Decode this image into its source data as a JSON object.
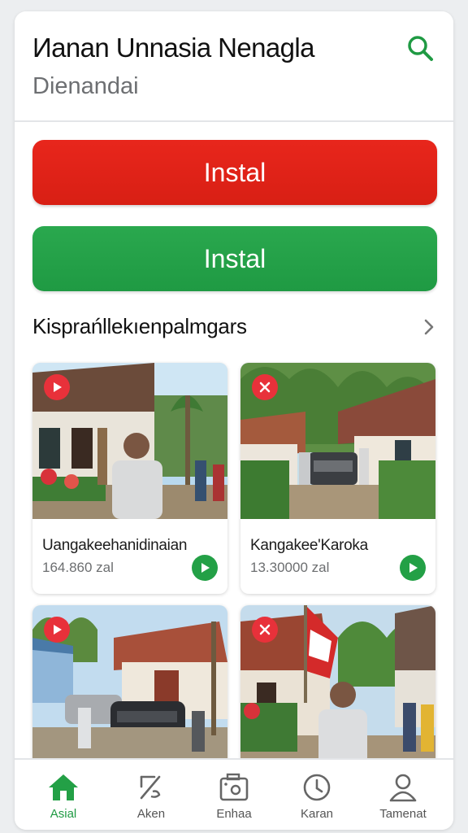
{
  "header": {
    "title": "Иanan Unnasia Nenagla",
    "subtitle": "Dienandai",
    "search_icon": "search-icon"
  },
  "actions": {
    "primary_label": "Instal",
    "secondary_label": "Instal",
    "primary_color": "#e0241a",
    "secondary_color": "#26a34a"
  },
  "section": {
    "title": "Kisprańllekıenpalmgars",
    "more_icon": "chevron-right-icon"
  },
  "cards": [
    {
      "name": "Uangakeehanidinaian",
      "count": "164.860 zal",
      "badge_icon": "play-icon"
    },
    {
      "name": "Kangakee'Karoka",
      "count": "13.30000 zal",
      "badge_icon": "close-icon"
    },
    {
      "name": "",
      "count": "",
      "badge_icon": "play-icon"
    },
    {
      "name": "",
      "count": "",
      "badge_icon": "close-icon"
    }
  ],
  "nav": {
    "items": [
      {
        "label": "Asial",
        "icon": "home-icon",
        "active": true
      },
      {
        "label": "Aken",
        "icon": "edit-icon",
        "active": false
      },
      {
        "label": "Enhaa",
        "icon": "camera-icon",
        "active": false
      },
      {
        "label": "Karan",
        "icon": "clock-icon",
        "active": false
      },
      {
        "label": "Tamenat",
        "icon": "user-icon",
        "active": false
      }
    ],
    "active_color": "#1f9a43"
  }
}
